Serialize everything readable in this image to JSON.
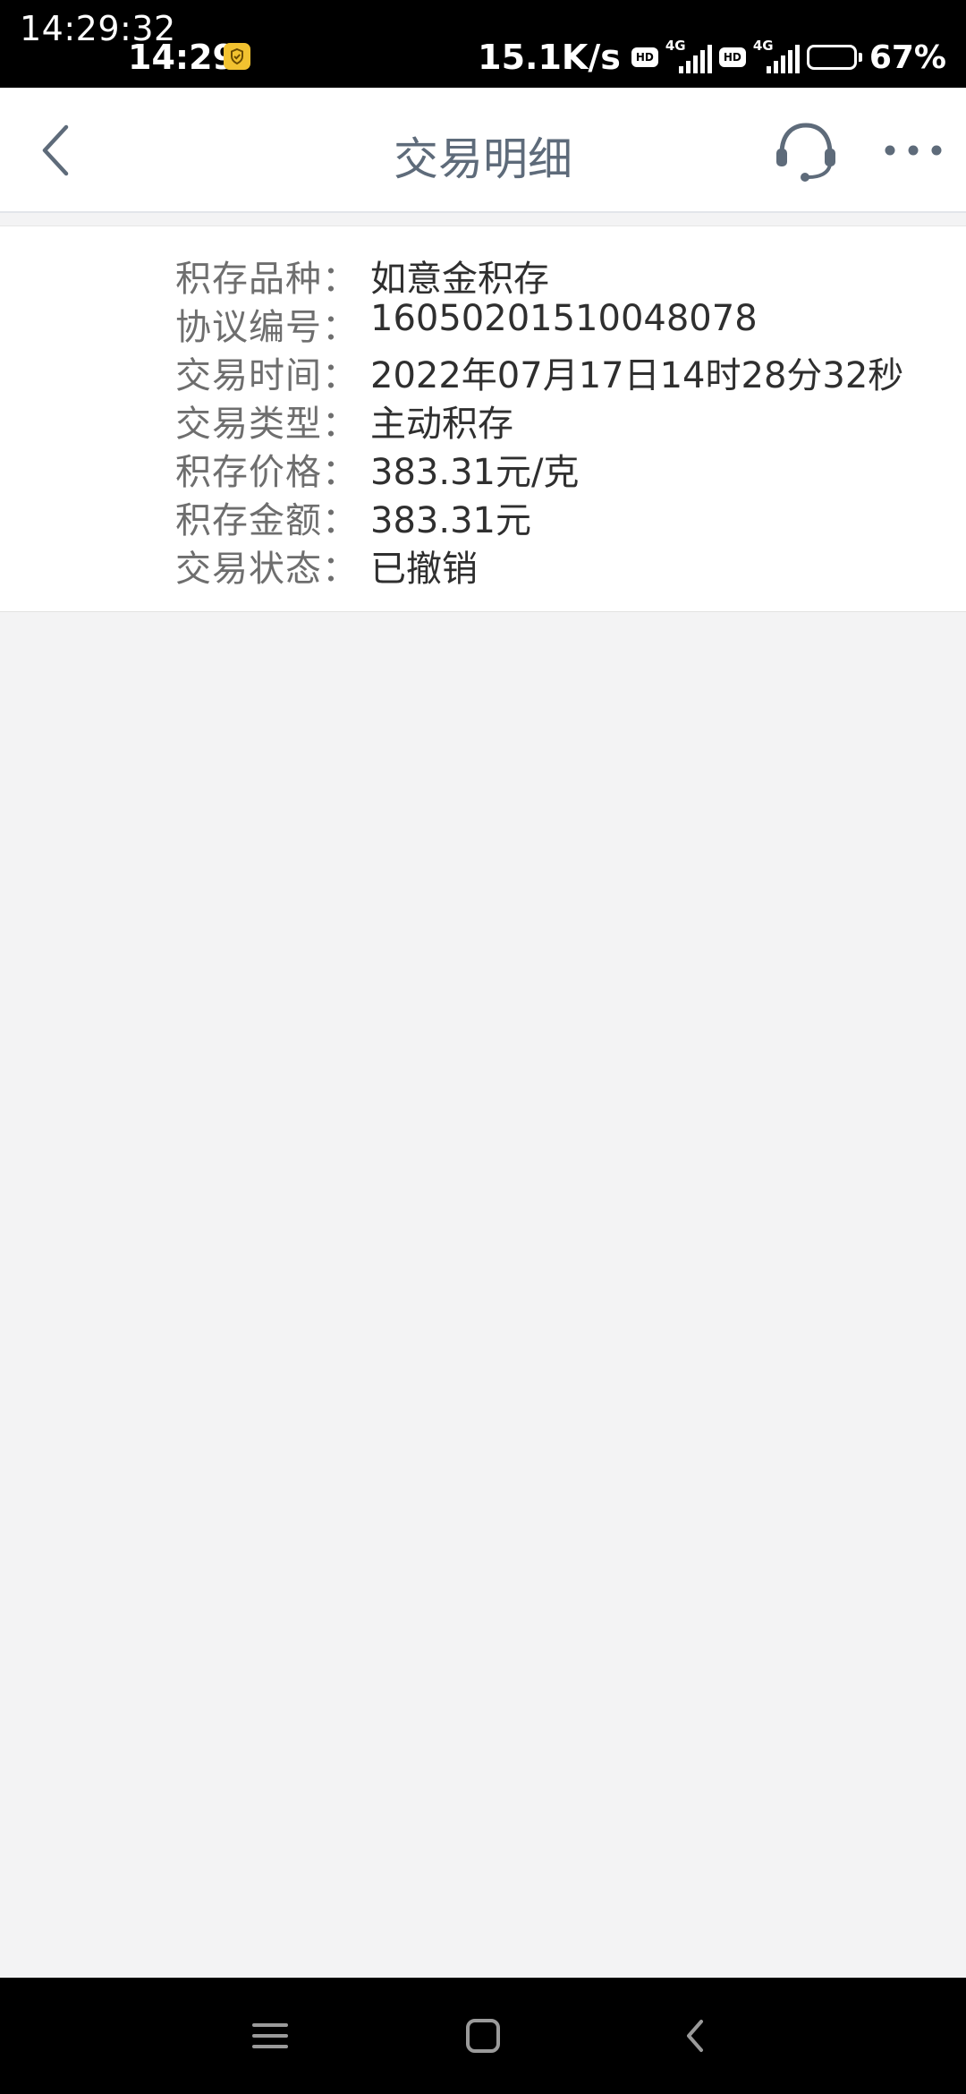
{
  "status_bar": {
    "overlay_time": "14:29:32",
    "time": "14:29",
    "network_speed": "15.1K/s",
    "hd_label": "HD",
    "network_type": "4G",
    "battery_level": 0.67,
    "battery_percent": "67%"
  },
  "header": {
    "title": "交易明细"
  },
  "details": [
    {
      "label": "积存品种：",
      "value": "如意金积存"
    },
    {
      "label": "协议编号：",
      "value": "16050201510048078"
    },
    {
      "label": "交易时间：",
      "value": "2022年07月17日14时28分32秒"
    },
    {
      "label": "交易类型：",
      "value": "主动积存"
    },
    {
      "label": "积存价格：",
      "value": "383.31元/克"
    },
    {
      "label": "积存金额：",
      "value": "383.31元"
    },
    {
      "label": "交易状态：",
      "value": "已撤销"
    }
  ],
  "colors": {
    "header_icon": "#5e6b7a",
    "label": "#6e6e6e",
    "value": "#2f2f2f",
    "background": "#f3f3f4"
  }
}
